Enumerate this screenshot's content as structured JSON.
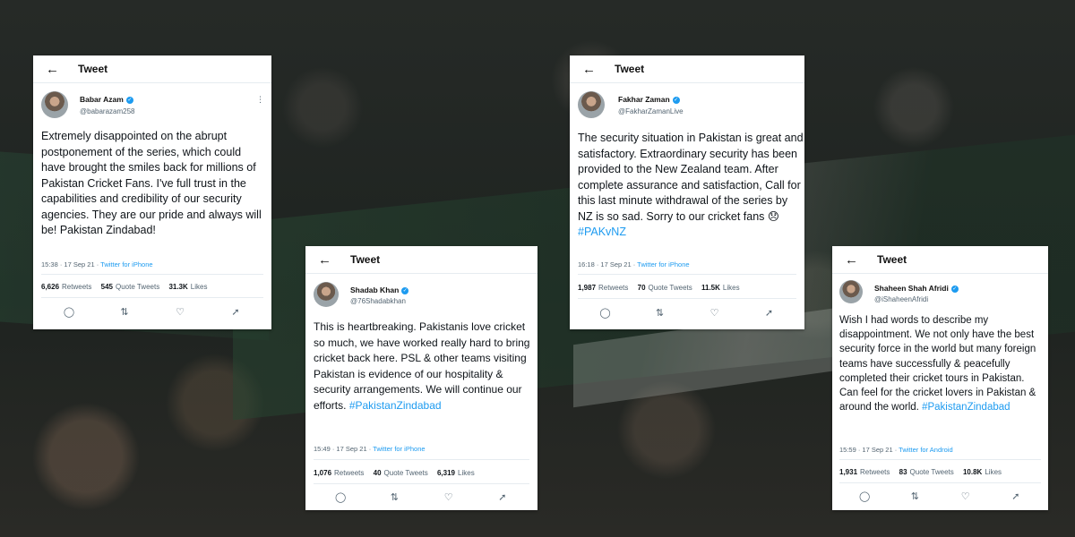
{
  "page": {
    "header_label": "Tweet",
    "back_icon": "arrow-left-icon"
  },
  "tweets": [
    {
      "name": "Babar Azam",
      "handle": "@babarazam258",
      "text": "Extremely disappointed on the abrupt postponement of the series, which could have brought the smiles back for millions of Pakistan Cricket Fans. I've full trust in the capabilities and credibility of our security agencies. They are our pride and always will be! Pakistan Zindabad!",
      "hashtag": "",
      "time": "15:38 · 17 Sep 21 · ",
      "source": "Twitter for iPhone",
      "retweets": "6,626",
      "retweets_label": "Retweets",
      "quotes": "545",
      "quotes_label": "Quote Tweets",
      "likes": "31.3K",
      "likes_label": "Likes"
    },
    {
      "name": "Shadab Khan",
      "handle": "@76Shadabkhan",
      "text": "This is heartbreaking. Pakistanis love cricket so much, we have worked really hard to bring cricket back here. PSL & other teams visiting Pakistan is evidence of our hospitality & security arrangements. We will continue our efforts.",
      "hashtag": "#PakistanZindabad",
      "time": "15:49 · 17 Sep 21 · ",
      "source": "Twitter for iPhone",
      "retweets": "1,076",
      "retweets_label": "Retweets",
      "quotes": "40",
      "quotes_label": "Quote Tweets",
      "likes": "6,319",
      "likes_label": "Likes"
    },
    {
      "name": "Fakhar Zaman",
      "handle": "@FakharZamanLive",
      "text": "The security situation in Pakistan is great and satisfactory. Extraordinary security has been provided to the New Zealand team. After complete assurance and satisfaction, Call for this last minute withdrawal of the series by NZ is so sad. Sorry to our cricket fans 😞 ",
      "hashtag": "#PAKvNZ",
      "time": "16:18 · 17 Sep 21 · ",
      "source": "Twitter for iPhone",
      "retweets": "1,987",
      "retweets_label": "Retweets",
      "quotes": "70",
      "quotes_label": "Quote Tweets",
      "likes": "11.5K",
      "likes_label": "Likes"
    },
    {
      "name": "Shaheen Shah Afridi",
      "handle": "@iShaheenAfridi",
      "text": "Wish I had words to describe my disappointment. We not only have the best security force in the world but many foreign teams have successfully & peacefully completed their cricket tours in Pakistan. Can feel for the cricket lovers in Pakistan & around the world.",
      "hashtag": "#PakistanZindabad",
      "time": "15:59 · 17 Sep 21 · ",
      "source": "Twitter for Android",
      "retweets": "1,931",
      "retweets_label": "Retweets",
      "quotes": "83",
      "quotes_label": "Quote Tweets",
      "likes": "10.8K",
      "likes_label": "Likes"
    }
  ]
}
